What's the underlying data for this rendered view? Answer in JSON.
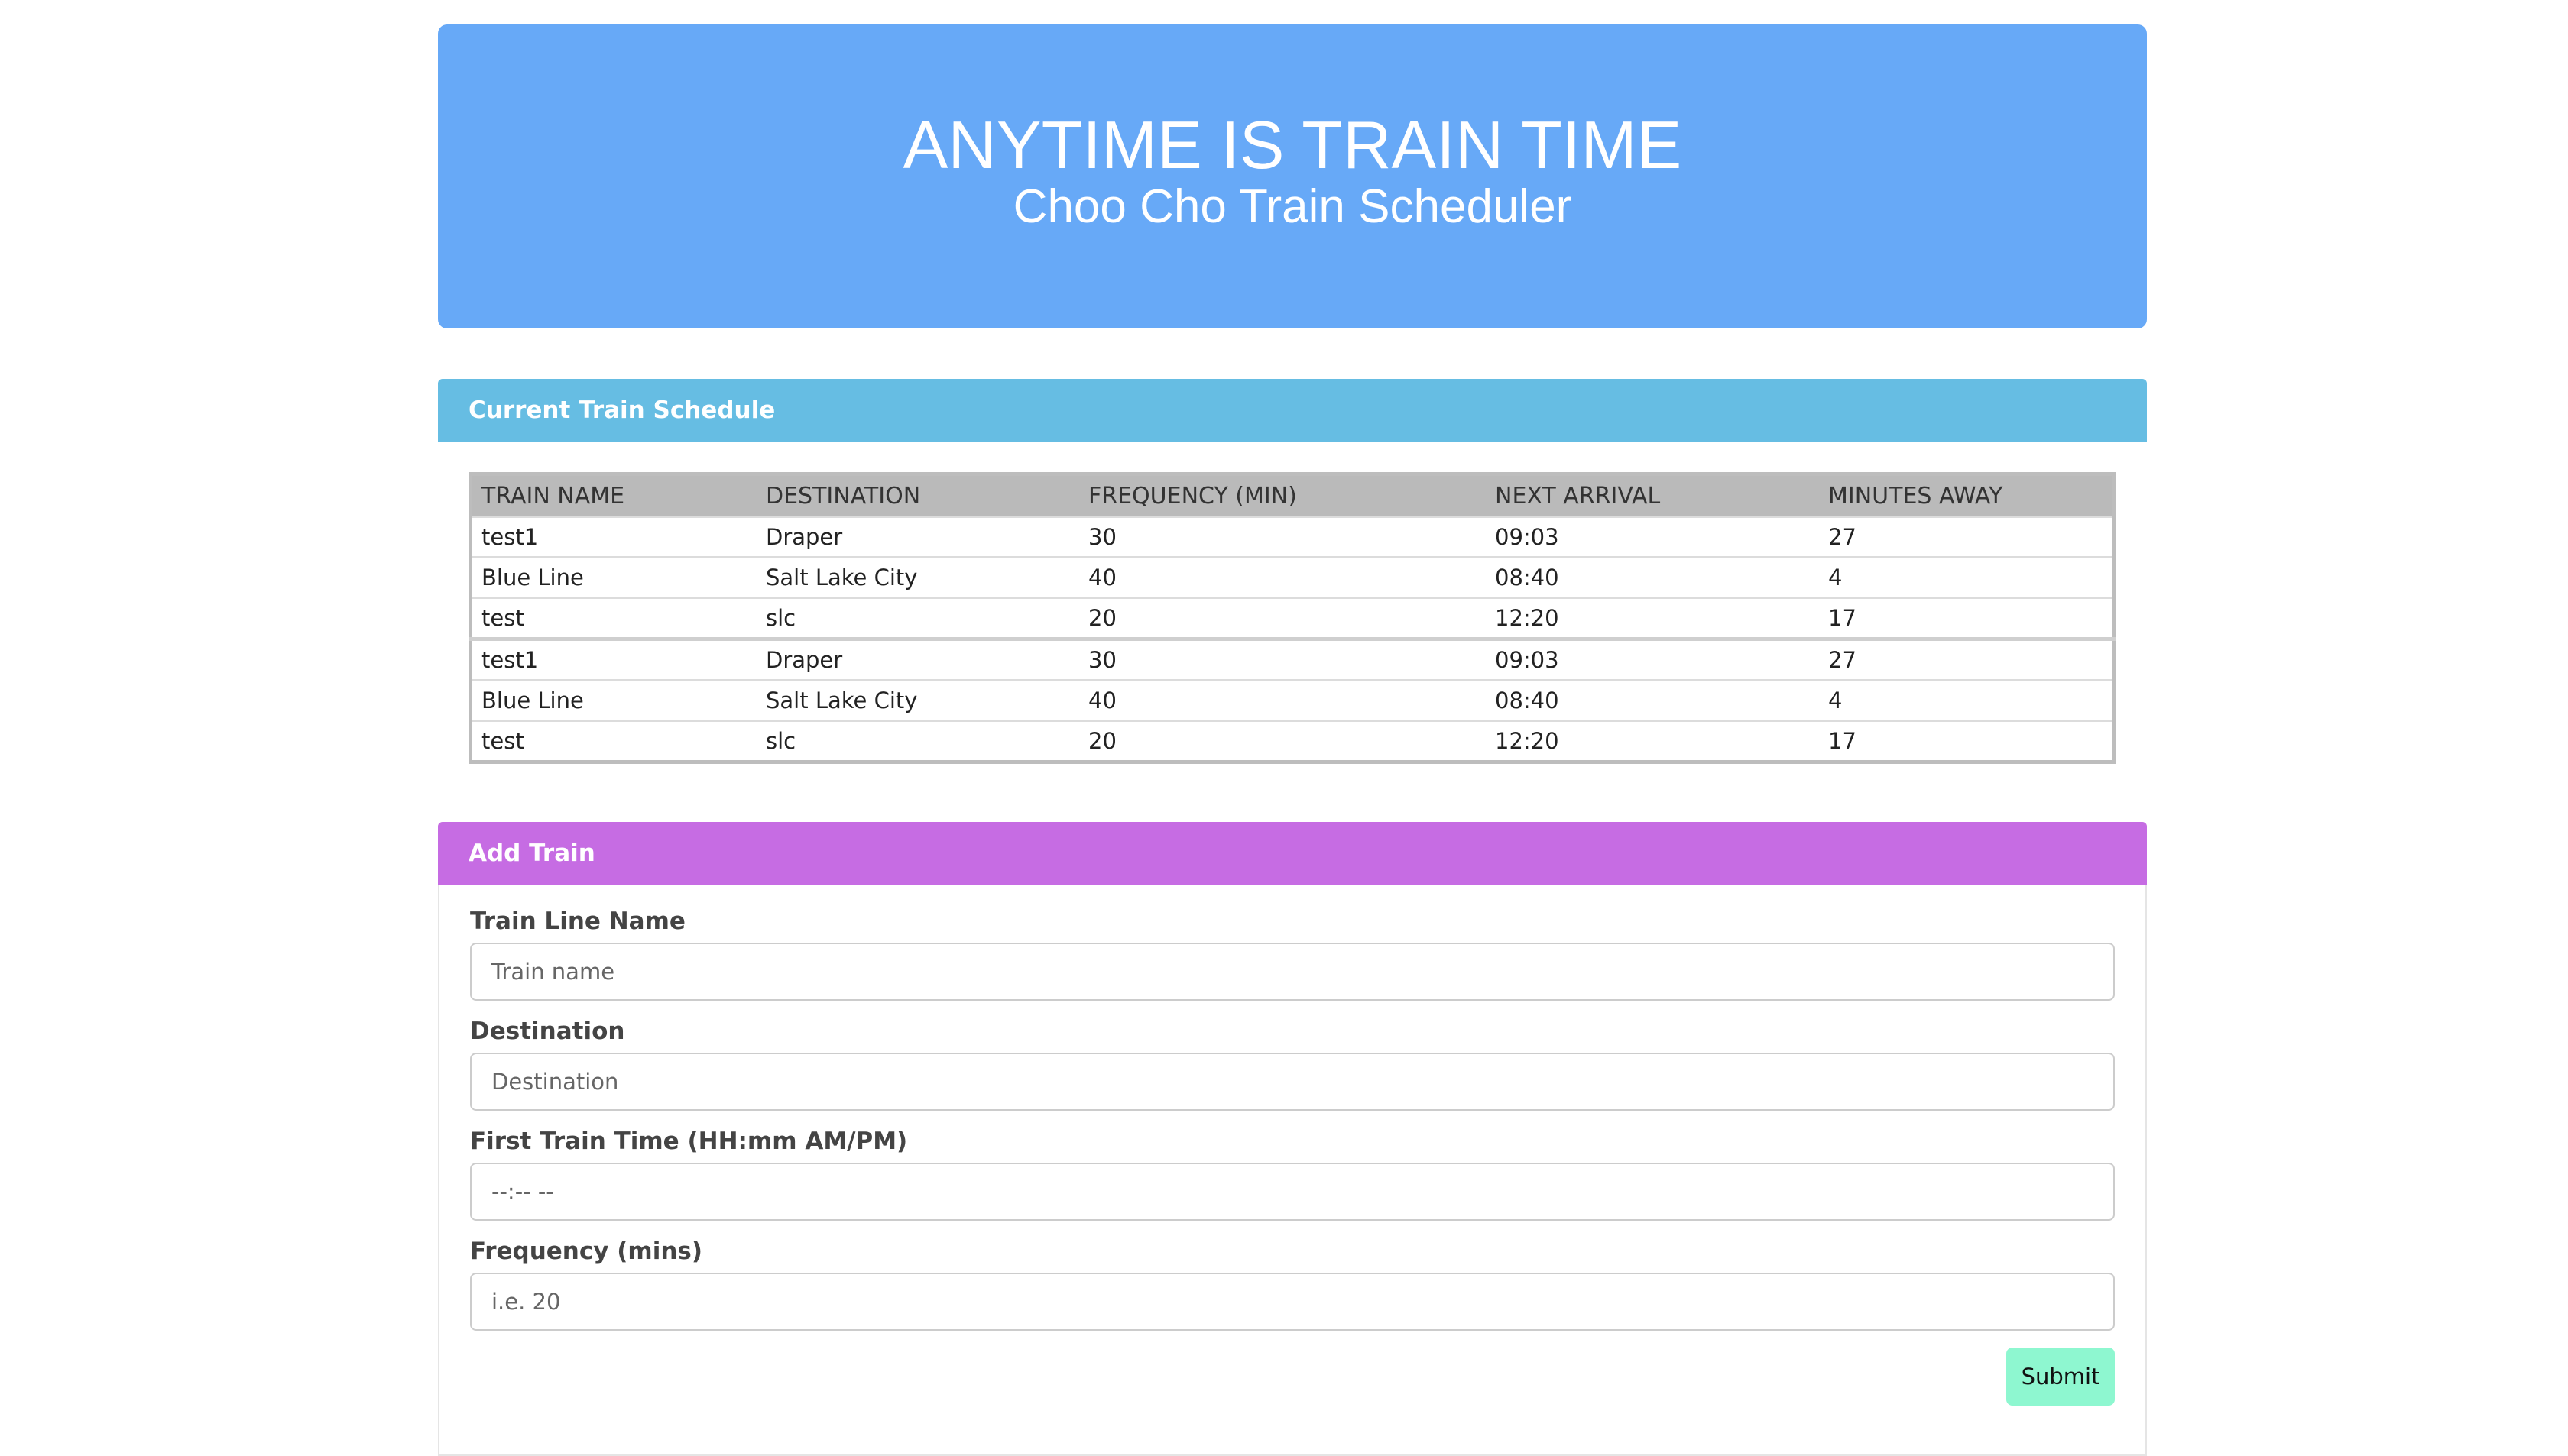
{
  "header": {
    "title": "ANYTIME IS TRAIN TIME",
    "subtitle": "Choo Cho Train Scheduler"
  },
  "schedule": {
    "heading": "Current Train Schedule",
    "columns": [
      "TRAIN NAME",
      "DESTINATION",
      "FREQUENCY (MIN)",
      "NEXT ARRIVAL",
      "MINUTES AWAY"
    ],
    "rows": [
      [
        "test1",
        "Draper",
        "30",
        "09:03",
        "27"
      ],
      [
        "Blue Line",
        "Salt Lake City",
        "40",
        "08:40",
        "4"
      ],
      [
        "test",
        "slc",
        "20",
        "12:20",
        "17"
      ],
      [
        "test1",
        "Draper",
        "30",
        "09:03",
        "27"
      ],
      [
        "Blue Line",
        "Salt Lake City",
        "40",
        "08:40",
        "4"
      ],
      [
        "test",
        "slc",
        "20",
        "12:20",
        "17"
      ]
    ]
  },
  "add_train": {
    "heading": "Add Train",
    "fields": [
      {
        "label": "Train Line Name",
        "value": "",
        "placeholder": "Train name"
      },
      {
        "label": "Destination",
        "value": "",
        "placeholder": "Destination"
      },
      {
        "label": "First Train Time (HH:mm AM/PM)",
        "value": "",
        "placeholder": "--:-- --"
      },
      {
        "label": "Frequency (mins)",
        "value": "",
        "placeholder": "i.e. 20"
      }
    ],
    "submit_label": "Submit"
  },
  "colors": {
    "jumbotron": "#67a9f7",
    "schedule_heading": "#66bde3",
    "add_heading": "#c66ce3",
    "submit": "#8ef7d0"
  }
}
